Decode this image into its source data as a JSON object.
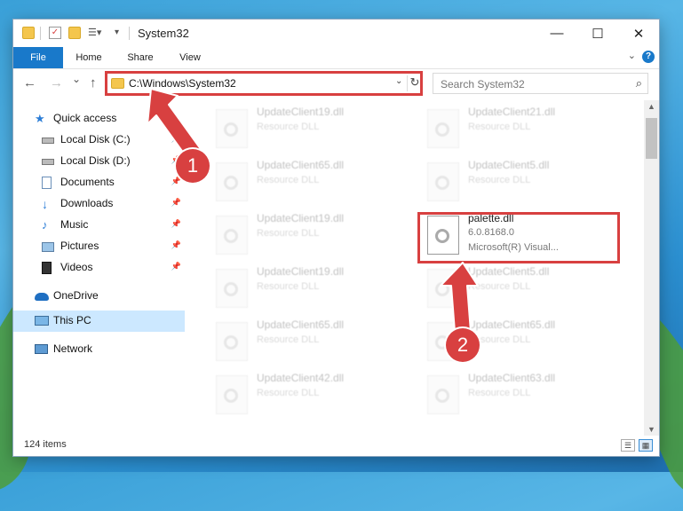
{
  "window": {
    "title": "System32",
    "controls": {
      "minimize": "—",
      "maximize": "☐",
      "close": "✕"
    }
  },
  "ribbon": {
    "tabs": [
      "File",
      "Home",
      "Share",
      "View"
    ],
    "help": "?"
  },
  "navbar": {
    "back": "←",
    "forward": "→",
    "recent": "⌄",
    "up": "↑",
    "address": "C:\\Windows\\System32",
    "search_placeholder": "Search System32"
  },
  "nav_pane": {
    "items": [
      {
        "label": "Quick access",
        "icon": "star-icon",
        "pinned": false
      },
      {
        "label": "Local Disk (C:)",
        "icon": "drive-icon",
        "pinned": true
      },
      {
        "label": "Local Disk (D:)",
        "icon": "drive-icon",
        "pinned": true
      },
      {
        "label": "Documents",
        "icon": "documents-icon",
        "pinned": true
      },
      {
        "label": "Downloads",
        "icon": "downloads-icon",
        "pinned": true
      },
      {
        "label": "Music",
        "icon": "music-icon",
        "pinned": true
      },
      {
        "label": "Pictures",
        "icon": "pictures-icon",
        "pinned": true
      },
      {
        "label": "Videos",
        "icon": "videos-icon",
        "pinned": true
      },
      {
        "label": "OneDrive",
        "icon": "cloud-icon",
        "pinned": false
      },
      {
        "label": "This PC",
        "icon": "computer-icon",
        "pinned": false,
        "selected": true
      },
      {
        "label": "Network",
        "icon": "network-icon",
        "pinned": false
      }
    ]
  },
  "files": [
    {
      "name": "UpdateClient19.dll",
      "desc": "Resource DLL",
      "faded": true
    },
    {
      "name": "UpdateClient21.dll",
      "desc": "Resource DLL",
      "faded": true
    },
    {
      "name": "UpdateClient65.dll",
      "desc": "Resource DLL",
      "faded": true
    },
    {
      "name": "UpdateClient5.dll",
      "desc": "Resource DLL",
      "faded": true
    },
    {
      "name": "UpdateClient19.dll",
      "desc": "Resource DLL",
      "faded": true
    },
    {
      "name": "palette.dll",
      "desc": "6.0.8168.0",
      "desc2": "Microsoft(R) Visual...",
      "faded": false
    },
    {
      "name": "UpdateClient19.dll",
      "desc": "Resource DLL",
      "faded": true
    },
    {
      "name": "UpdateClient5.dll",
      "desc": "Resource DLL",
      "faded": true
    },
    {
      "name": "UpdateClient65.dll",
      "desc": "Resource DLL",
      "faded": true
    },
    {
      "name": "UpdateClient65.dll",
      "desc": "Resource DLL",
      "faded": true
    },
    {
      "name": "UpdateClient42.dll",
      "desc": "Resource DLL",
      "faded": true
    },
    {
      "name": "UpdateClient63.dll",
      "desc": "Resource DLL",
      "faded": true
    }
  ],
  "status": {
    "item_count": "124 items"
  },
  "annotations": {
    "step1": "1",
    "step2": "2",
    "color": "#d84040"
  }
}
